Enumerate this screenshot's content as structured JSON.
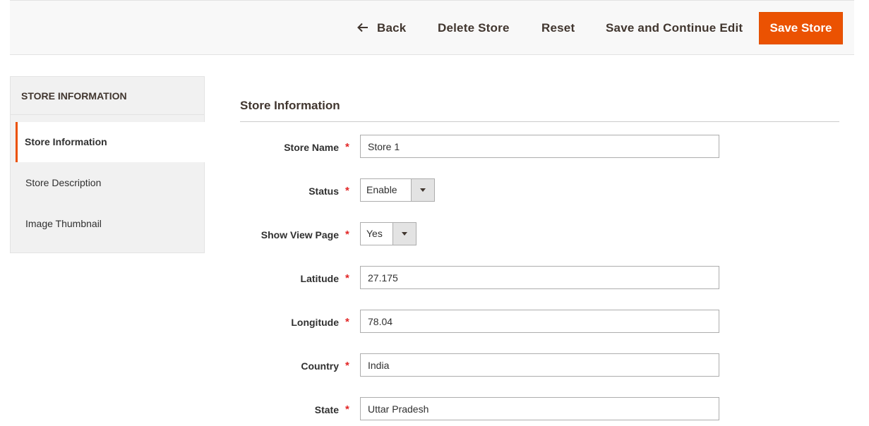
{
  "actions": {
    "back": "Back",
    "delete": "Delete Store",
    "reset": "Reset",
    "save_continue": "Save and Continue Edit",
    "save": "Save Store",
    "accent": "#eb5202"
  },
  "sidebar": {
    "title": "STORE INFORMATION",
    "items": [
      {
        "label": "Store Information",
        "active": true
      },
      {
        "label": "Store Description",
        "active": false
      },
      {
        "label": "Image Thumbnail",
        "active": false
      }
    ]
  },
  "form": {
    "section_title": "Store Information",
    "required_mark": "*",
    "fields": {
      "store_name": {
        "label": "Store Name",
        "value": "Store 1"
      },
      "status": {
        "label": "Status",
        "value": "Enable"
      },
      "show_view_page": {
        "label": "Show View Page",
        "value": "Yes"
      },
      "latitude": {
        "label": "Latitude",
        "value": "27.175"
      },
      "longitude": {
        "label": "Longitude",
        "value": "78.04"
      },
      "country": {
        "label": "Country",
        "value": "India"
      },
      "state": {
        "label": "State",
        "value": "Uttar Pradesh"
      }
    }
  },
  "icons": {
    "back": "arrow-left-icon",
    "select_toggle": "chevron-down-icon"
  }
}
